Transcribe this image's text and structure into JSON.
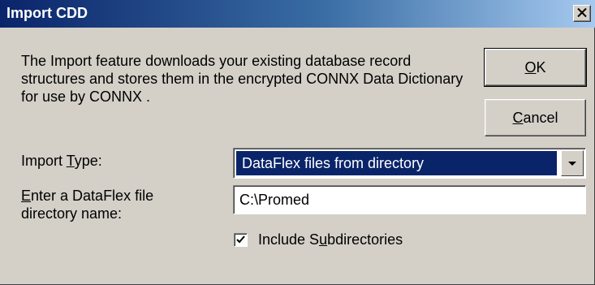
{
  "window": {
    "title": "Import CDD",
    "close_glyph": "✕"
  },
  "description": "The Import feature downloads your existing database record structures and stores them in the encrypted CONNX Data Dictionary for use by CONNX .",
  "buttons": {
    "ok": {
      "label": "OK",
      "mnemonic_index": 0
    },
    "cancel": {
      "label": "Cancel",
      "mnemonic_index": 0
    }
  },
  "import_type": {
    "label": "Import Type:",
    "mnemonic_index": 7,
    "value": "DataFlex files from directory"
  },
  "directory": {
    "label": "Enter a DataFlex file directory name:",
    "label_line1": "Enter a DataFlex file",
    "label_line2": "directory name:",
    "value": "C:\\Promed"
  },
  "include_subdirectories": {
    "label": "Include Subdirectories",
    "checked": true
  },
  "colors": {
    "face": "#d4d0c8",
    "title_start": "#0a246a",
    "title_end": "#a6caf0",
    "selection": "#0a246a"
  }
}
